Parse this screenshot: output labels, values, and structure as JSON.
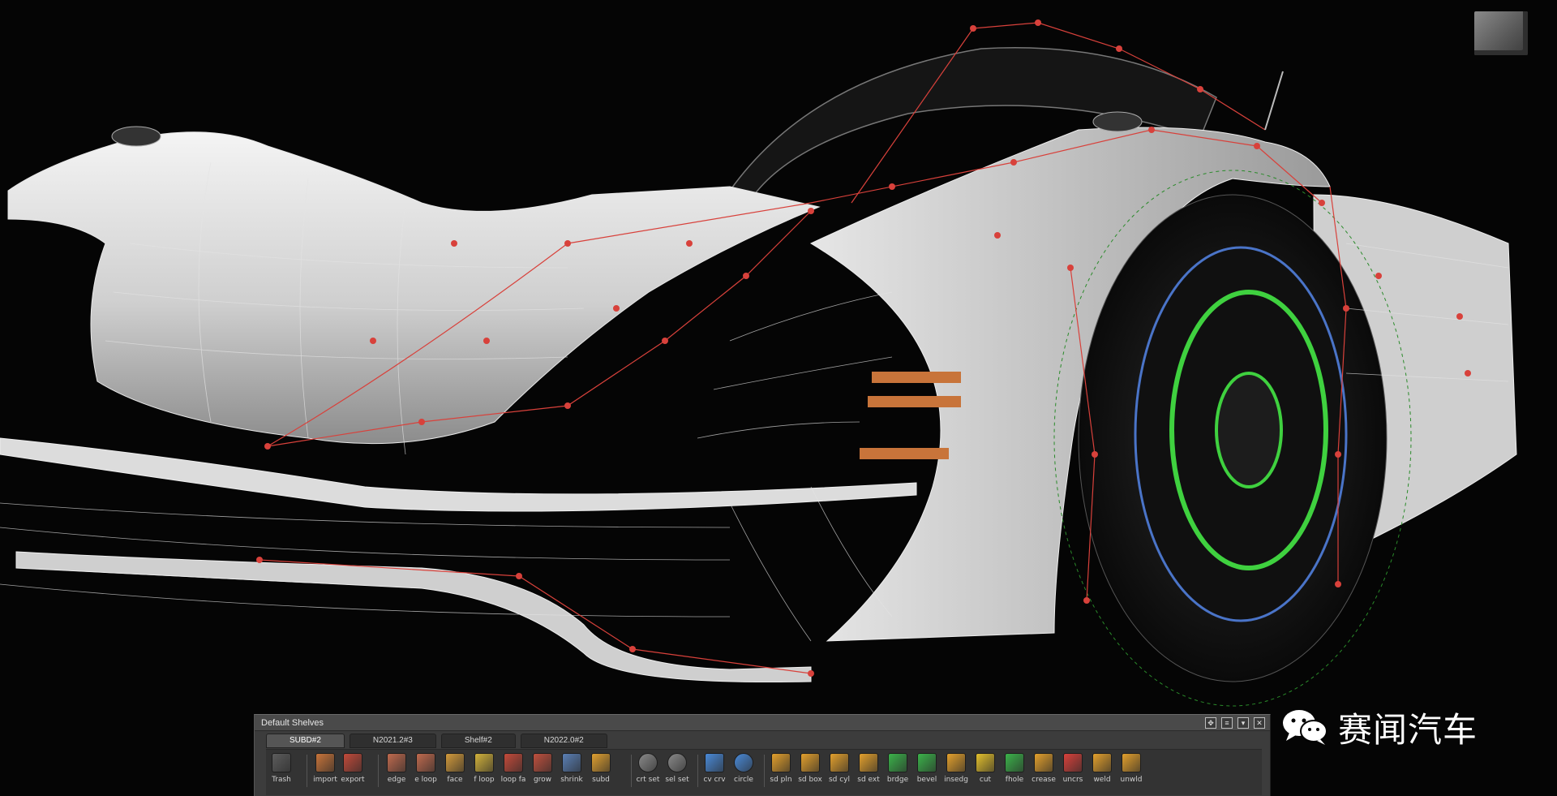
{
  "viewport": {
    "content": "3D car surface model with subdivision control cage",
    "cage_color": "#d8413b",
    "wire_color": "#e8e8e8",
    "body_color": "#d9d9d9",
    "wheel_accent": "#3fd13f",
    "rim_ring": "#4a74c8"
  },
  "watermark": {
    "text": "赛闻汽车",
    "icon": "wechat-icon"
  },
  "shelf": {
    "title": "Default Shelves",
    "tabs": [
      {
        "label": "SUBD#2",
        "active": true
      },
      {
        "label": "N2021.2#3",
        "active": false
      },
      {
        "label": "Shelf#2",
        "active": false
      },
      {
        "label": "N2022.0#2",
        "active": false
      }
    ],
    "tools": [
      {
        "label": "Trash",
        "icon": "trash-icon",
        "color": "#5c5c5c"
      },
      {
        "label": "import",
        "icon": "import-icon",
        "color": "#c8743a"
      },
      {
        "label": "export",
        "icon": "export-icon",
        "color": "#c24a3a"
      },
      {
        "label": "edge",
        "icon": "edge-select-icon",
        "color": "#c06a4e"
      },
      {
        "label": "e loop",
        "icon": "edge-loop-icon",
        "color": "#c06a4e"
      },
      {
        "label": "face",
        "icon": "face-select-icon",
        "color": "#d29a3b"
      },
      {
        "label": "f loop",
        "icon": "face-loop-icon",
        "color": "#d2b23b"
      },
      {
        "label": "loop fa",
        "icon": "loop-face-icon",
        "color": "#c44a3a"
      },
      {
        "label": "grow",
        "icon": "grow-icon",
        "color": "#c0503e"
      },
      {
        "label": "shrink",
        "icon": "shrink-icon",
        "color": "#5a7fb5"
      },
      {
        "label": "subd",
        "icon": "subd-icon",
        "color": "#e0a030"
      },
      {
        "label": "crt set",
        "icon": "create-set-icon",
        "color": "#8a8a8a"
      },
      {
        "label": "sel set",
        "icon": "select-set-icon",
        "color": "#8a8a8a"
      },
      {
        "label": "cv crv",
        "icon": "cv-curve-icon",
        "color": "#4a8ad8"
      },
      {
        "label": "circle",
        "icon": "circle-icon",
        "color": "#4a8ad8"
      },
      {
        "label": "sd pln",
        "icon": "subd-plane-icon",
        "color": "#e3a02c"
      },
      {
        "label": "sd box",
        "icon": "subd-box-icon",
        "color": "#e3a02c"
      },
      {
        "label": "sd cyl",
        "icon": "subd-cylinder-icon",
        "color": "#e3a02c"
      },
      {
        "label": "sd ext",
        "icon": "subd-extrude-icon",
        "color": "#e3a02c"
      },
      {
        "label": "brdge",
        "icon": "bridge-icon",
        "color": "#3bb34a"
      },
      {
        "label": "bevel",
        "icon": "bevel-icon",
        "color": "#3bb34a"
      },
      {
        "label": "insedg",
        "icon": "insert-edge-icon",
        "color": "#e3a02c"
      },
      {
        "label": "cut",
        "icon": "cut-icon",
        "color": "#e3c02c"
      },
      {
        "label": "fhole",
        "icon": "fill-hole-icon",
        "color": "#3bb34a"
      },
      {
        "label": "crease",
        "icon": "crease-icon",
        "color": "#e3a02c"
      },
      {
        "label": "uncrs",
        "icon": "uncrease-icon",
        "color": "#d8413b"
      },
      {
        "label": "weld",
        "icon": "weld-icon",
        "color": "#e3a02c"
      },
      {
        "label": "unwld",
        "icon": "unweld-icon",
        "color": "#e3a02c"
      }
    ]
  }
}
